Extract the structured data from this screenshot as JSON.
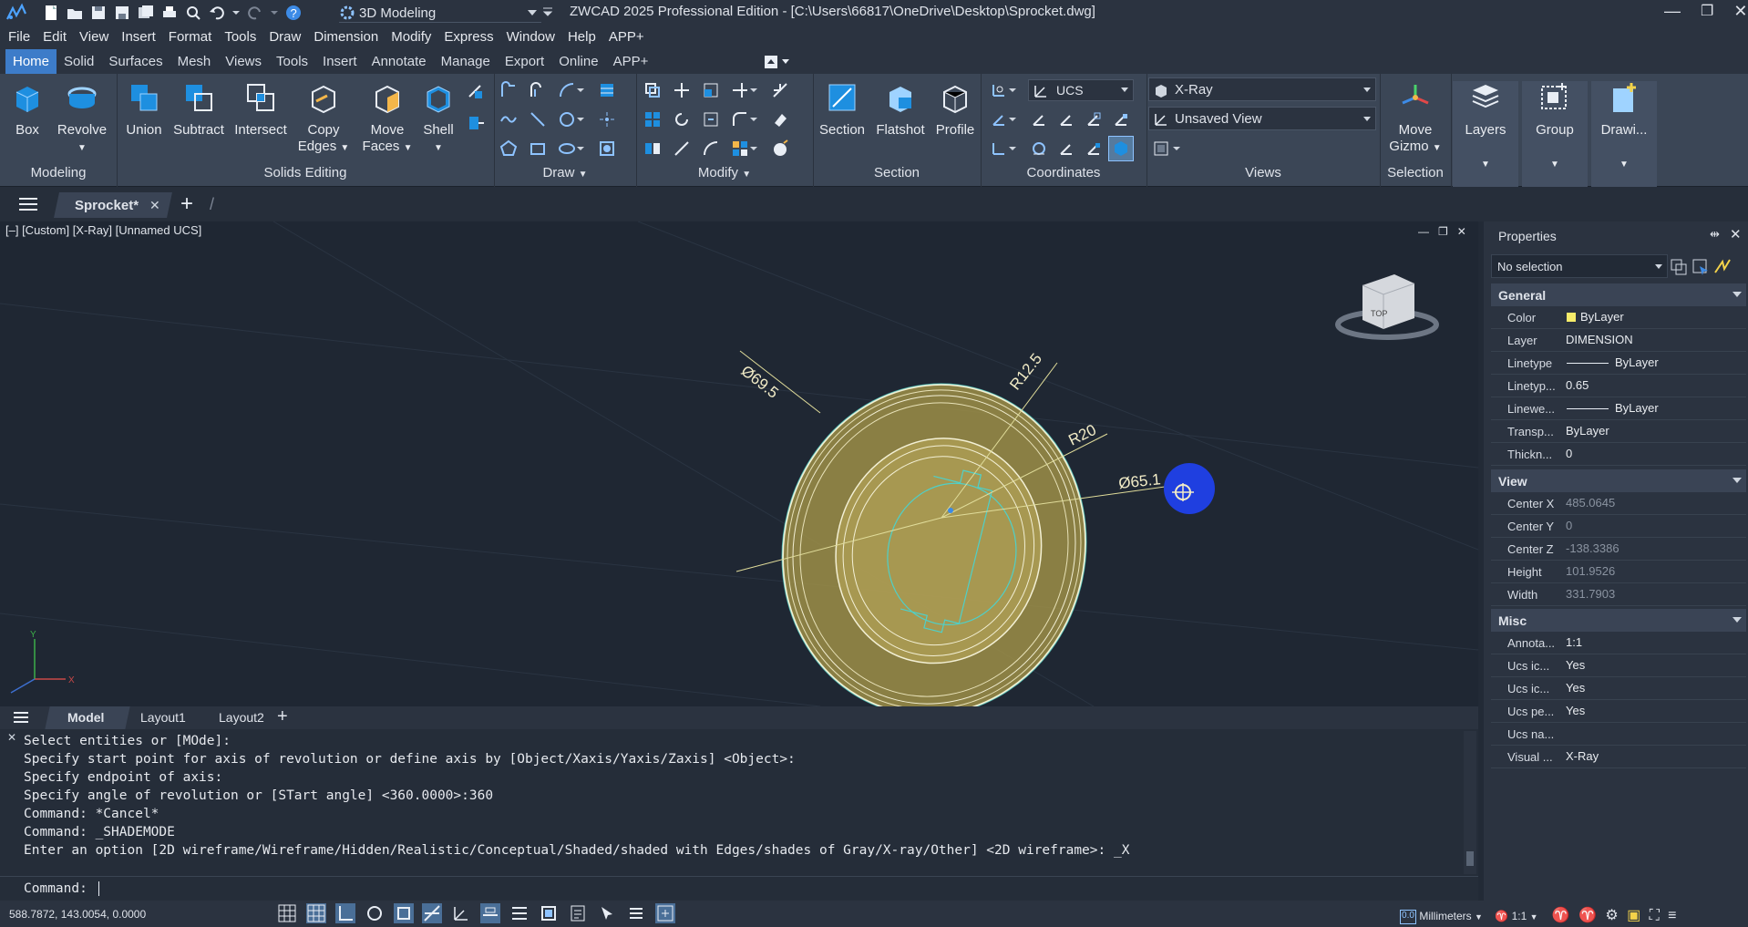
{
  "titlebar": {
    "workspace": "3D Modeling",
    "title": "ZWCAD 2025 Professional Edition - [C:\\Users\\66817\\OneDrive\\Desktop\\Sprocket.dwg]"
  },
  "menu": [
    "File",
    "Edit",
    "View",
    "Insert",
    "Format",
    "Tools",
    "Draw",
    "Dimension",
    "Modify",
    "Express",
    "Window",
    "Help",
    "APP+"
  ],
  "ribbon_tabs": [
    "Home",
    "Solid",
    "Surfaces",
    "Mesh",
    "Views",
    "Tools",
    "Insert",
    "Annotate",
    "Manage",
    "Export",
    "Online",
    "APP+"
  ],
  "ribbon": {
    "modeling": {
      "label": "Modeling",
      "box": "Box",
      "revolve": "Revolve"
    },
    "solids_editing": {
      "label": "Solids Editing",
      "union": "Union",
      "subtract": "Subtract",
      "intersect": "Intersect",
      "copy_edges_1": "Copy",
      "copy_edges_2": "Edges",
      "move_faces_1": "Move",
      "move_faces_2": "Faces",
      "shell": "Shell"
    },
    "draw": {
      "label": "Draw"
    },
    "modify": {
      "label": "Modify"
    },
    "section": {
      "label": "Section",
      "section": "Section",
      "flatshot": "Flatshot",
      "profile": "Profile"
    },
    "coordinates": {
      "label": "Coordinates",
      "ucs_value": "UCS"
    },
    "views": {
      "label": "Views",
      "visual_style": "X-Ray",
      "named_view": "Unsaved View"
    },
    "selection": {
      "label": "Selection",
      "move_gizmo_1": "Move",
      "move_gizmo_2": "Gizmo"
    },
    "layers": "Layers",
    "group": "Group",
    "drawing": "Drawi..."
  },
  "doc_tab": "Sprocket*",
  "viewport_label": "[–] [Custom] [X-Ray] [Unnamed UCS]",
  "viewcube_label": "TOP",
  "dims": {
    "d1": "Ø69.5",
    "d2": "R12.5",
    "d3": "R20",
    "d4": "Ø65.1"
  },
  "ucs_axes": {
    "x": "X",
    "y": "Y"
  },
  "layout_tabs": [
    "Model",
    "Layout1",
    "Layout2"
  ],
  "command_history": [
    "Select entities or [MOde]:",
    "Specify start point for axis of revolution or define axis by [Object/Xaxis/Yaxis/Zaxis] <Object>:",
    "Specify endpoint of axis:",
    "Specify angle of revolution or [STart angle] <360.0000>:360",
    "Command: *Cancel*",
    "Command: _SHADEMODE",
    "Enter an option [2D wireframe/Wireframe/Hidden/Realistic/Conceptual/Shaded/shaded with Edges/shades of Gray/X-ray/Other] <2D wireframe>: _X"
  ],
  "command_prompt": "Command:",
  "status": {
    "coords": "588.7872, 143.0054, 0.0000",
    "units": "Millimeters",
    "scale": "1:1"
  },
  "properties": {
    "title": "Properties",
    "selection": "No selection",
    "general_label": "General",
    "general": [
      {
        "k": "Color",
        "v": "ByLayer"
      },
      {
        "k": "Layer",
        "v": "DIMENSION"
      },
      {
        "k": "Linetype",
        "v": "ByLayer"
      },
      {
        "k": "Linetyp...",
        "v": "0.65"
      },
      {
        "k": "Linewe...",
        "v": "ByLayer"
      },
      {
        "k": "Transp...",
        "v": "ByLayer"
      },
      {
        "k": "Thickn...",
        "v": "0"
      }
    ],
    "view_label": "View",
    "view": [
      {
        "k": "Center X",
        "v": "485.0645"
      },
      {
        "k": "Center Y",
        "v": "0"
      },
      {
        "k": "Center Z",
        "v": "-138.3386"
      },
      {
        "k": "Height",
        "v": "101.9526"
      },
      {
        "k": "Width",
        "v": "331.7903"
      }
    ],
    "misc_label": "Misc",
    "misc": [
      {
        "k": "Annota...",
        "v": "1:1"
      },
      {
        "k": "Ucs ic...",
        "v": "Yes"
      },
      {
        "k": "Ucs ic...",
        "v": "Yes"
      },
      {
        "k": "Ucs pe...",
        "v": "Yes"
      },
      {
        "k": "Ucs na...",
        "v": ""
      },
      {
        "k": "Visual ...",
        "v": "X-Ray"
      }
    ]
  },
  "colors": {
    "accent": "#3d7cc9",
    "solid_fill": "#b8a75a",
    "solid_edge": "#f3f0d5",
    "dim_line": "#e0dc9a",
    "grip": "#2a3fe0"
  }
}
